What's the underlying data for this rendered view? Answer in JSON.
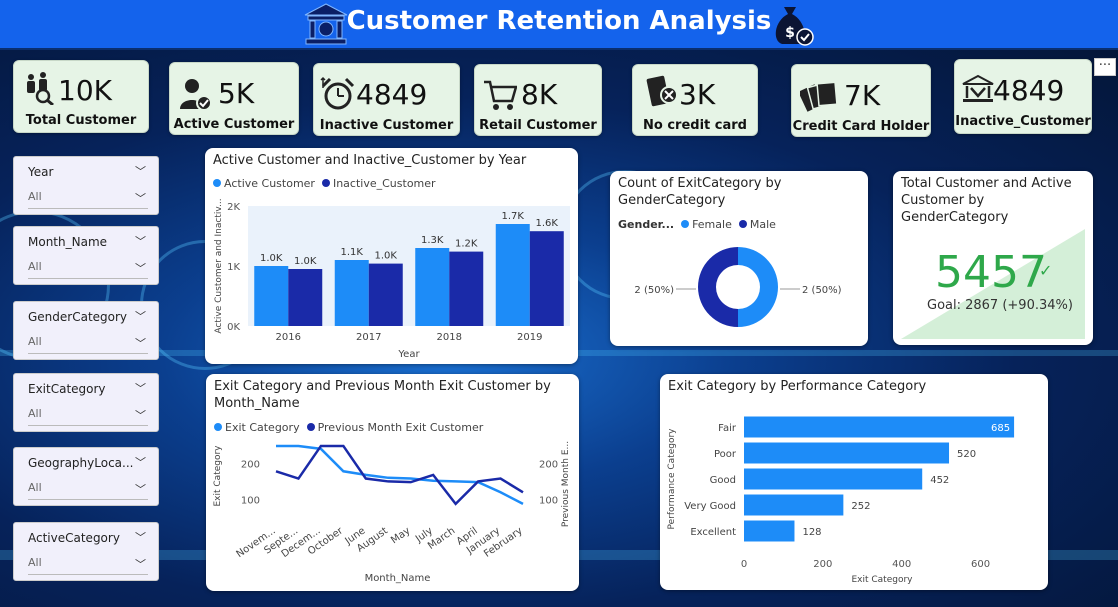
{
  "title": "Customer Retention Analysis",
  "kpis": [
    {
      "value": "10K",
      "label": "Total Customer",
      "icon": "customers-search-icon"
    },
    {
      "value": "5K",
      "label": "Active Customer",
      "icon": "user-check-icon"
    },
    {
      "value": "4849",
      "label": "Inactive  Customer",
      "icon": "alarm-clock-icon"
    },
    {
      "value": "8K",
      "label": "Retail Customer",
      "icon": "shopping-cart-icon"
    },
    {
      "value": "3K",
      "label": "No credit card",
      "icon": "no-card-icon"
    },
    {
      "value": "7K",
      "label": "Credit Card Holder",
      "icon": "credit-cards-icon"
    },
    {
      "value": "4849",
      "label": "Inactive_Customer",
      "icon": "bank-down-icon"
    }
  ],
  "slicers": [
    {
      "name": "Year",
      "value": "All"
    },
    {
      "name": "Month_Name",
      "value": "All"
    },
    {
      "name": "GenderCategory",
      "value": "All"
    },
    {
      "name": "ExitCategory",
      "value": "All"
    },
    {
      "name": "GeographyLoca...",
      "value": "All"
    },
    {
      "name": "ActiveCategory",
      "value": "All"
    }
  ],
  "more_options": "···",
  "colors": {
    "active": "#1d8cf8",
    "inactive": "#1a2aa8",
    "title_bar": "#1463ec",
    "kpi_bg": "#e6f4e6",
    "gauge_green": "#2ea84a"
  },
  "chart_data": [
    {
      "type": "bar",
      "title": "Active Customer and Inactive_Customer by Year",
      "xlabel": "Year",
      "ylabel": "Active Customer and Inactiv...",
      "categories": [
        "2016",
        "2017",
        "2018",
        "2019"
      ],
      "series": [
        {
          "name": "Active Customer",
          "values": [
            1000,
            1100,
            1300,
            1700
          ],
          "labels": [
            "1.0K",
            "1.1K",
            "1.3K",
            "1.7K"
          ]
        },
        {
          "name": "Inactive_Customer",
          "values": [
            950,
            1040,
            1240,
            1580
          ],
          "labels": [
            "1.0K",
            "1.0K",
            "1.2K",
            "1.6K"
          ]
        }
      ],
      "ylim": [
        0,
        2000
      ],
      "yticks": [
        "0K",
        "1K",
        "2K"
      ]
    },
    {
      "type": "pie",
      "title": "Count of ExitCategory by GenderCategory",
      "legend_title": "Gender...",
      "series": [
        {
          "name": "Female",
          "value": 2,
          "label": "2 (50%)"
        },
        {
          "name": "Male",
          "value": 2,
          "label": "2 (50%)"
        }
      ]
    },
    {
      "type": "line",
      "title": "Exit Category and Previous Month Exit Customer by Month_Name",
      "xlabel": "Month_Name",
      "ylabel": "Exit Category",
      "y2label": "Previous Month E...",
      "categories": [
        "Novem...",
        "Septe...",
        "Decem...",
        "October",
        "June",
        "August",
        "May",
        "July",
        "March",
        "April",
        "January",
        "February"
      ],
      "series": [
        {
          "name": "Exit Category",
          "values": [
            248,
            248,
            240,
            178,
            168,
            160,
            158,
            152,
            150,
            148,
            120,
            88
          ]
        },
        {
          "name": "Previous Month Exit Customer",
          "values": [
            178,
            158,
            248,
            248,
            158,
            150,
            148,
            168,
            88,
            150,
            158,
            120
          ]
        }
      ],
      "yticks": [
        "100",
        "200"
      ],
      "ylim": [
        60,
        270
      ]
    },
    {
      "type": "bar",
      "orientation": "horizontal",
      "title": "Exit Category by Performance Category",
      "xlabel": "Exit Category",
      "ylabel": "Performance Category",
      "categories": [
        "Fair",
        "Poor",
        "Good",
        "Very Good",
        "Excellent"
      ],
      "values": [
        685,
        520,
        452,
        252,
        128
      ],
      "xticks": [
        "0",
        "200",
        "400",
        "600"
      ],
      "xlim": [
        0,
        700
      ]
    }
  ],
  "gauge": {
    "title": "Total Customer and Active Customer by GenderCategory",
    "value": "5457",
    "goal": "Goal: 2867 (+90.34%)",
    "check": "✓"
  }
}
